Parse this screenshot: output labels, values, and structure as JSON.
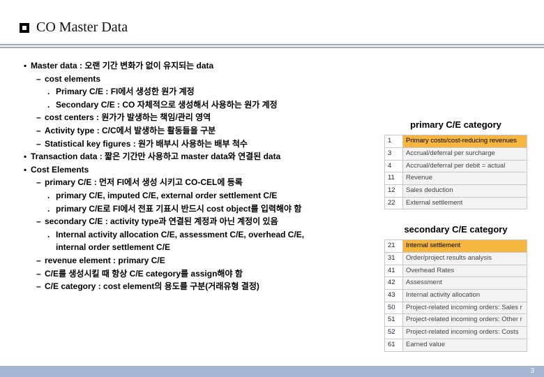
{
  "title": "CO Master Data",
  "body": {
    "l0": "Master data : 오랜 기간 변화가 없이 유지되는 data",
    "l1": "cost elements",
    "l2": "Primary C/E : FI에서 생성한 원가 계정",
    "l3": "Secondary C/E : CO 자체적으로 생성해서 사용하는 원가 계정",
    "l4": "cost centers : 원가가 발생하는 책임/관리 영역",
    "l5": "Activity type : C/C에서 발생하는 활동들을 구분",
    "l6": "Statistical key figures : 원가 배부시 사용하는  배부 척수",
    "l7": "Transaction data : 짧은 기간만 사용하고 master data와 연결된 data",
    "l8": "Cost Elements",
    "l9": "primary C/E : 먼저 FI에서 생성 시키고 CO-CEL에 등록",
    "l10": "primary C/E, imputed C/E, external order settlement C/E",
    "l11": "primary C/E로 FI에서 전표 기표시 반드시 cost object를 입력해야 함",
    "l12": "secondary C/E : activity type과 연결된 계정과 아닌 계정이 있음",
    "l13": "Internal activity allocation C/E, assessment C/E, overhead C/E,",
    "l14": "internal order settlement C/E",
    "l15": "revenue element : primary C/E",
    "l16": "C/E를 생성시킬 때 항상 C/E category를 assign해야 함",
    "l17": "C/E category : cost element의 용도를 구분(거래유형 결정)"
  },
  "table1": {
    "title": "primary C/E category",
    "rows": [
      {
        "a": "1",
        "b": "Primary costs/cost-reducing revenues"
      },
      {
        "a": "3",
        "b": "Accrual/deferral per surcharge"
      },
      {
        "a": "4",
        "b": "Accrual/deferral per debit = actual"
      },
      {
        "a": "11",
        "b": "Revenue"
      },
      {
        "a": "12",
        "b": "Sales deduction"
      },
      {
        "a": "22",
        "b": "External settlement"
      }
    ]
  },
  "table2": {
    "title": "secondary C/E category",
    "rows": [
      {
        "a": "21",
        "b": "Internal settlement"
      },
      {
        "a": "31",
        "b": "Order/project results analysis"
      },
      {
        "a": "41",
        "b": "Overhead Rates"
      },
      {
        "a": "42",
        "b": "Assessment"
      },
      {
        "a": "43",
        "b": "Internal activity allocation"
      },
      {
        "a": "50",
        "b": "Project-related incoming orders: Sales r"
      },
      {
        "a": "51",
        "b": "Project-related incoming orders: Other r"
      },
      {
        "a": "52",
        "b": "Project-related incoming orders: Costs"
      },
      {
        "a": "61",
        "b": "Earned value"
      }
    ]
  },
  "page": "3"
}
